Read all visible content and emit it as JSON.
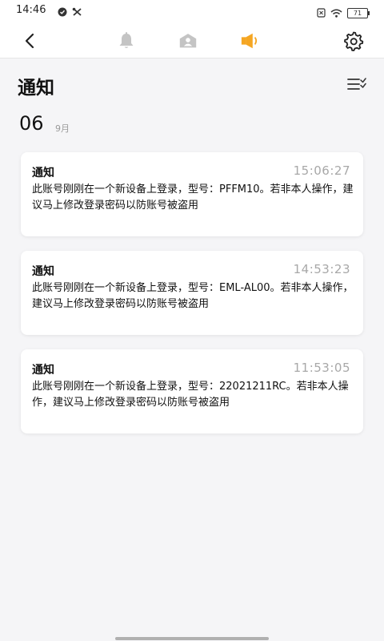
{
  "status_bar": {
    "time": "14:46",
    "battery": "71"
  },
  "nav": {
    "active_tab": "speaker",
    "icons": [
      "back-arrow",
      "bell",
      "contact-card",
      "speaker",
      "gear"
    ],
    "active_color": "#f5a623",
    "inactive_color": "#c4c4c4"
  },
  "page": {
    "title": "通知"
  },
  "date_group": {
    "day": "06",
    "month": "9月"
  },
  "notifications": [
    {
      "title": "通知",
      "time": "15:06:27",
      "body": "此账号刚刚在一个新设备上登录，型号：PFFM10。若非本人操作，建议马上修改登录密码以防账号被盗用"
    },
    {
      "title": "通知",
      "time": "14:53:23",
      "body": "此账号刚刚在一个新设备上登录，型号：EML-AL00。若非本人操作，建议马上修改登录密码以防账号被盗用"
    },
    {
      "title": "通知",
      "time": "11:53:05",
      "body": "此账号刚刚在一个新设备上登录，型号：22021211RC。若非本人操作，建议马上修改登录密码以防账号被盗用"
    }
  ]
}
